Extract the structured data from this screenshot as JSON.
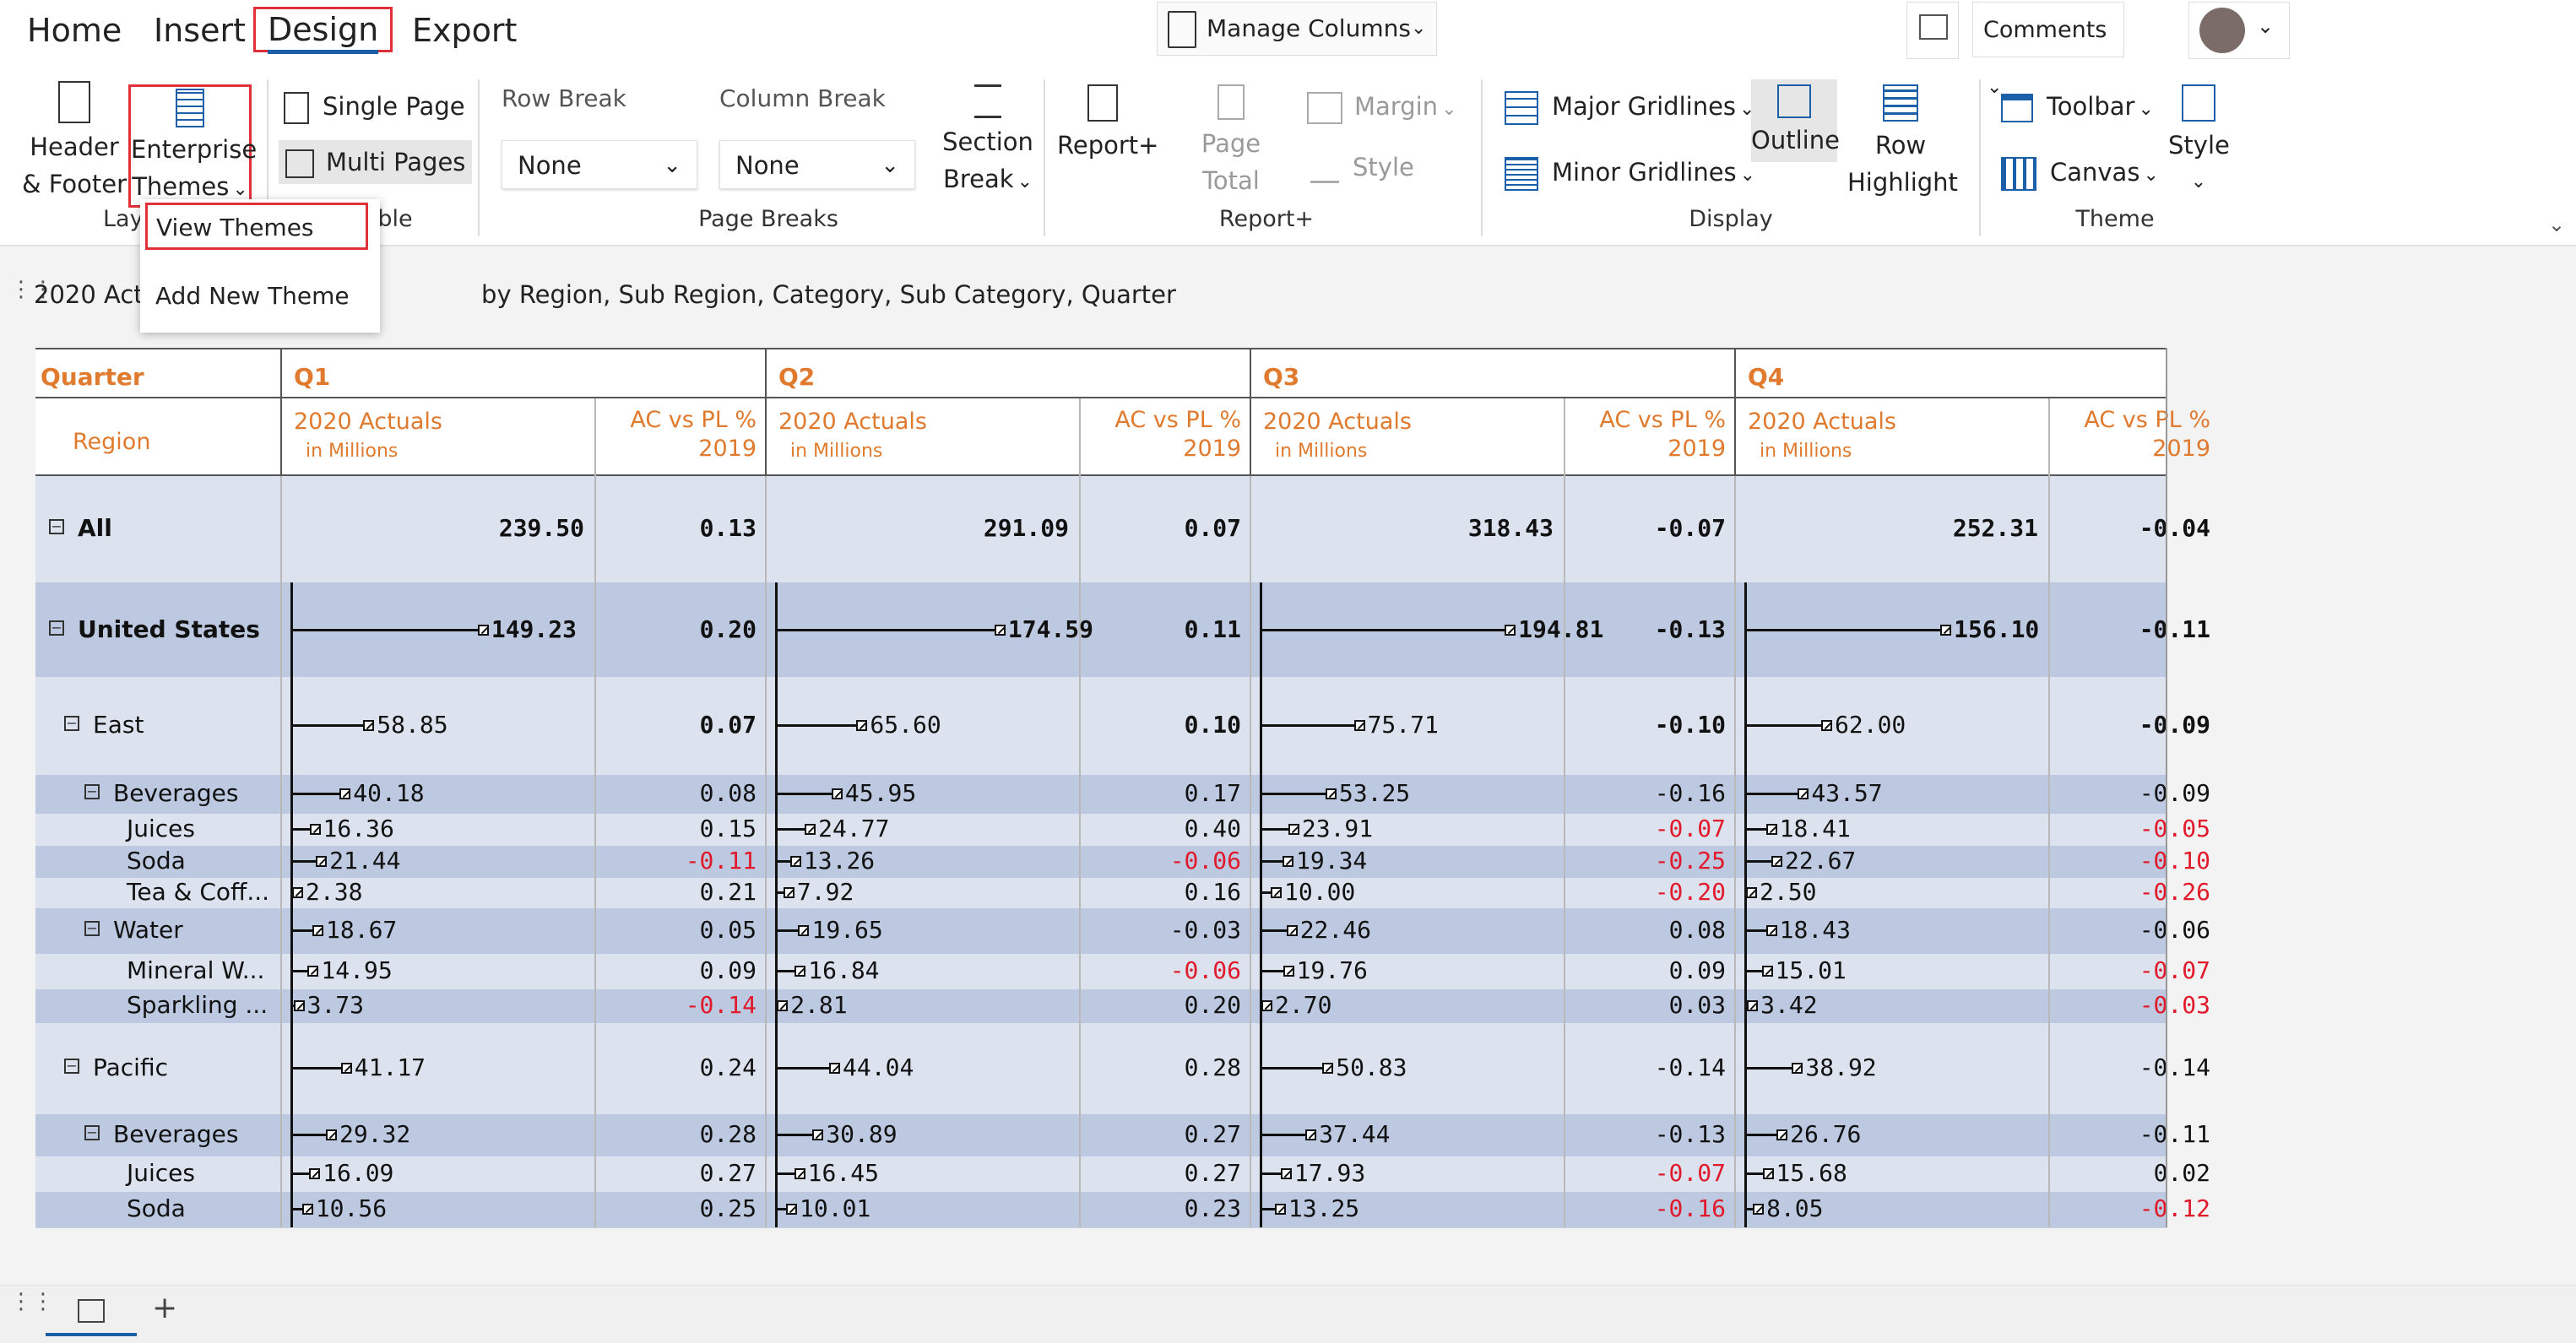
{
  "tabs": [
    "Home",
    "Insert",
    "Design",
    "Export"
  ],
  "active_tab": "Design",
  "manage_columns": "Manage Columns",
  "comments": "Comments",
  "ribbon": {
    "header_footer": [
      "Header",
      "& Footer"
    ],
    "enterprise_themes": [
      "Enterprise",
      "Themes"
    ],
    "single_page": "Single Page",
    "multi_pages": "Multi Pages",
    "row_break_label": "Row Break",
    "row_break_value": "None",
    "column_break_label": "Column Break",
    "column_break_value": "None",
    "section_break": [
      "Section",
      "Break"
    ],
    "report_plus": "Report+",
    "page_total": "Page Total",
    "margin": "Margin",
    "style_small": "Style",
    "major_gridlines": "Major Gridlines",
    "minor_gridlines": "Minor Gridlines",
    "outline": "Outline",
    "row_highlight": [
      "Row",
      "Highlight"
    ],
    "toolbar": "Toolbar",
    "canvas": "Canvas",
    "style": "Style",
    "groups": {
      "layout": "Lay",
      "table": "ble",
      "page_breaks": "Page Breaks",
      "report_plus": "Report+",
      "display": "Display",
      "theme": "Theme"
    }
  },
  "menu": {
    "view_themes": "View Themes",
    "add_new_theme": "Add New Theme"
  },
  "report_title_left": "2020 Actu",
  "report_title_right": "by Region, Sub Region, Category, Sub Category, Quarter",
  "table": {
    "corner_quarter": "Quarter",
    "corner_region": "Region",
    "quarters": [
      "Q1",
      "Q2",
      "Q3",
      "Q4"
    ],
    "measure1": "2020 Actuals",
    "measure1_unit": "in Millions",
    "measure2_top": "AC vs PL %",
    "measure2_bottom": "2019",
    "rows": [
      {
        "label": "All",
        "level": 0,
        "bold": true,
        "values": [
          "239.50",
          "0.13",
          "291.09",
          "0.07",
          "318.43",
          "-0.07",
          "252.31",
          "-0.04"
        ]
      },
      {
        "label": "United States",
        "level": 0,
        "bold": true,
        "values": [
          "149.23",
          "0.20",
          "174.59",
          "0.11",
          "194.81",
          "-0.13",
          "156.10",
          "-0.11"
        ]
      },
      {
        "label": "East",
        "level": 1,
        "bold": false,
        "values": [
          "58.85",
          "0.07",
          "65.60",
          "0.10",
          "75.71",
          "-0.10",
          "62.00",
          "-0.09"
        ]
      },
      {
        "label": "Beverages",
        "level": 2,
        "bold": false,
        "values": [
          "40.18",
          "0.08",
          "45.95",
          "0.17",
          "53.25",
          "-0.16",
          "43.57",
          "-0.09"
        ]
      },
      {
        "label": "Juices",
        "level": 3,
        "bold": false,
        "values": [
          "16.36",
          "0.15",
          "24.77",
          "0.40",
          "23.91",
          "-0.07",
          "18.41",
          "-0.05"
        ]
      },
      {
        "label": "Soda",
        "level": 3,
        "bold": false,
        "values": [
          "21.44",
          "-0.11",
          "13.26",
          "-0.06",
          "19.34",
          "-0.25",
          "22.67",
          "-0.10"
        ]
      },
      {
        "label": "Tea & Coff...",
        "level": 3,
        "bold": false,
        "values": [
          "2.38",
          "0.21",
          "7.92",
          "0.16",
          "10.00",
          "-0.20",
          "2.50",
          "-0.26"
        ]
      },
      {
        "label": "Water",
        "level": 2,
        "bold": false,
        "values": [
          "18.67",
          "0.05",
          "19.65",
          "-0.03",
          "22.46",
          "0.08",
          "18.43",
          "-0.06"
        ]
      },
      {
        "label": "Mineral W...",
        "level": 3,
        "bold": false,
        "values": [
          "14.95",
          "0.09",
          "16.84",
          "-0.06",
          "19.76",
          "0.09",
          "15.01",
          "-0.07"
        ]
      },
      {
        "label": "Sparkling ...",
        "level": 3,
        "bold": false,
        "values": [
          "3.73",
          "-0.14",
          "2.81",
          "0.20",
          "2.70",
          "0.03",
          "3.42",
          "-0.03"
        ]
      },
      {
        "label": "Pacific",
        "level": 1,
        "bold": false,
        "values": [
          "41.17",
          "0.24",
          "44.04",
          "0.28",
          "50.83",
          "-0.14",
          "38.92",
          "-0.14"
        ]
      },
      {
        "label": "Beverages",
        "level": 2,
        "bold": false,
        "values": [
          "29.32",
          "0.28",
          "30.89",
          "0.27",
          "37.44",
          "-0.13",
          "26.76",
          "-0.11"
        ]
      },
      {
        "label": "Juices",
        "level": 3,
        "bold": false,
        "values": [
          "16.09",
          "0.27",
          "16.45",
          "0.27",
          "17.93",
          "-0.07",
          "15.68",
          "0.02"
        ]
      },
      {
        "label": "Soda",
        "level": 3,
        "bold": false,
        "values": [
          "10.56",
          "0.25",
          "10.01",
          "0.23",
          "13.25",
          "-0.16",
          "8.05",
          "-0.12"
        ]
      }
    ],
    "negative_color": "#e0192b",
    "header_color": "#e07a2e",
    "row_shade_dark": "#bcc9e0",
    "row_shade_light": "#dce3ef"
  }
}
